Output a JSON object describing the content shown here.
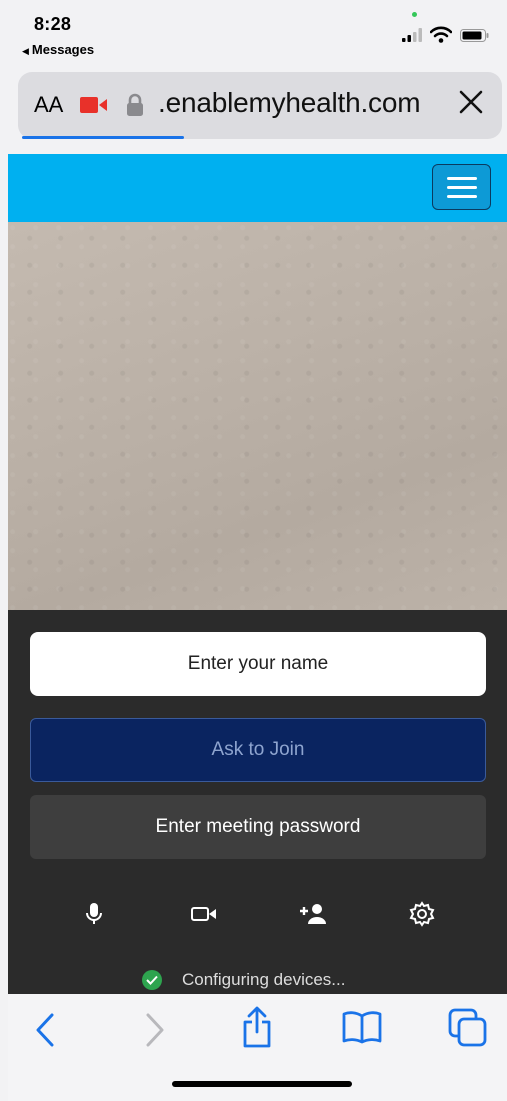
{
  "status_bar": {
    "time": "8:28",
    "back_app": "Messages",
    "back_glyph": "◀"
  },
  "browser": {
    "text_size_label": "AA",
    "url": ".enablemyhealth.com",
    "accent_color": "#1a73e8"
  },
  "page": {
    "header_color": "#00b0f0",
    "name_placeholder": "Enter your name",
    "join_label": "Ask to Join",
    "password_label": "Enter meeting password",
    "toolbar_icons": [
      "microphone-icon",
      "video-camera-icon",
      "add-participant-icon",
      "settings-icon"
    ],
    "status_text": "Configuring devices..."
  },
  "toolbar": {
    "icons": [
      "back-icon",
      "forward-icon",
      "share-icon",
      "bookmarks-icon",
      "tabs-icon"
    ]
  }
}
